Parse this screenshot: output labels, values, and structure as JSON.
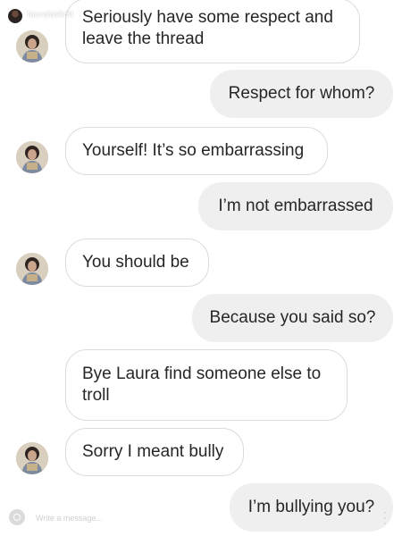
{
  "header": {
    "username": "lauralaskett"
  },
  "messages": [
    {
      "direction": "in",
      "text_line1": "Seriously have some respect and",
      "text_line2": "leave the thread",
      "has_avatar": true
    },
    {
      "direction": "out",
      "text": "Respect for whom?"
    },
    {
      "direction": "in",
      "text": "Yourself! It’s so embarrassing",
      "has_avatar": true
    },
    {
      "direction": "out",
      "text": "I’m not embarrassed"
    },
    {
      "direction": "in",
      "text": "You should be",
      "has_avatar": true
    },
    {
      "direction": "out",
      "text": "Because you said so?"
    },
    {
      "direction": "in",
      "text_line1": "Bye Laura find someone else to",
      "text_line2": "troll",
      "has_avatar": false
    },
    {
      "direction": "in",
      "text": "Sorry I meant bully",
      "has_avatar": true
    },
    {
      "direction": "out",
      "text": "I’m bullying you?"
    }
  ],
  "composer": {
    "placeholder": "Write a message...",
    "camera_icon": "camera-icon",
    "more_icon": "more-vertical-icon"
  },
  "colors": {
    "incoming_bubble_bg": "#ffffff",
    "incoming_bubble_border": "#dbdbdb",
    "outgoing_bubble_bg": "#efefef",
    "text": "#262626"
  }
}
